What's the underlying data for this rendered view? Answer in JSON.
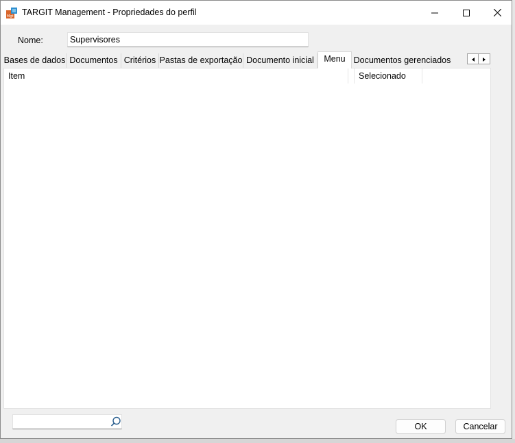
{
  "window": {
    "title": "TARGIT Management - Propriedades do perfil",
    "app_icon": "mgt-app-icon",
    "controls": [
      "minimize-icon",
      "maximize-icon",
      "close-icon"
    ]
  },
  "form": {
    "name_label": "Nome:",
    "name_value": "Supervisores"
  },
  "tabs": [
    {
      "label": "Bases de dados",
      "active": false
    },
    {
      "label": "Documentos",
      "active": false
    },
    {
      "label": "Critérios",
      "active": false
    },
    {
      "label": "Pastas de exportação",
      "active": false
    },
    {
      "label": "Documento inicial",
      "active": false
    },
    {
      "label": "Menu",
      "active": true
    },
    {
      "label": "Documentos gerenciados",
      "active": false
    }
  ],
  "tab_scroll": {
    "left_icon": "arrow-left-icon",
    "right_icon": "arrow-right-icon"
  },
  "list": {
    "columns": [
      "Item",
      "Selecionado"
    ],
    "rows": []
  },
  "search": {
    "value": "",
    "icon": "search-icon"
  },
  "buttons": {
    "ok": "OK",
    "cancel": "Cancelar"
  },
  "colors": {
    "accent_icon": "#2f8fcf",
    "icon_orange": "#d9662b"
  }
}
